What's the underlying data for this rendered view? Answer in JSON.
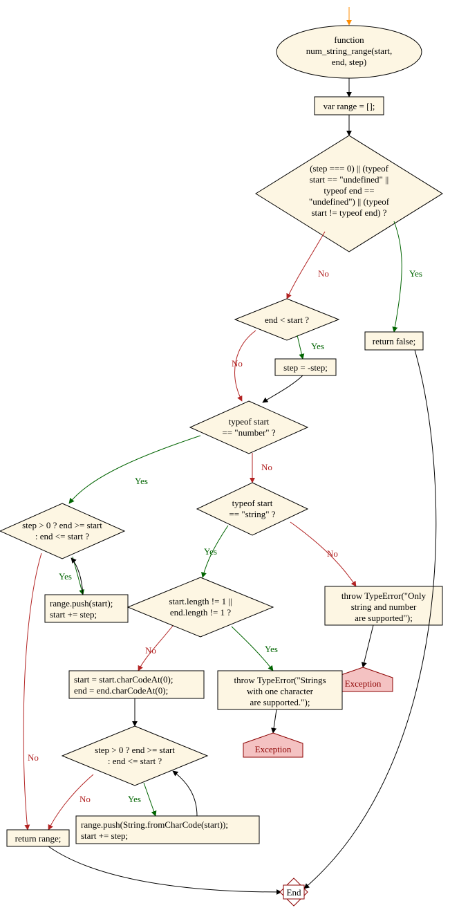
{
  "chart_data": {
    "type": "flowchart",
    "nodes": {
      "n_func": {
        "kind": "terminal",
        "lines": [
          "function",
          "num_string_range(start,",
          "end, step)"
        ]
      },
      "n_varr": {
        "kind": "process",
        "lines": [
          "var range = [];"
        ]
      },
      "n_check": {
        "kind": "decision",
        "lines": [
          "(step === 0) || (typeof",
          "start == \"undefined\" ||",
          "typeof end ==",
          "\"undefined\") || (typeof",
          "start != typeof end) ?"
        ]
      },
      "n_retf": {
        "kind": "process",
        "lines": [
          "return false;"
        ]
      },
      "n_endlt": {
        "kind": "decision",
        "lines": [
          "end < start ?"
        ]
      },
      "n_neg": {
        "kind": "process",
        "lines": [
          "step = -step;"
        ]
      },
      "n_isnum": {
        "kind": "decision",
        "lines": [
          "typeof start",
          "== \"number\" ?"
        ]
      },
      "n_isstr": {
        "kind": "decision",
        "lines": [
          "typeof start",
          "== \"string\" ?"
        ]
      },
      "n_len": {
        "kind": "decision",
        "lines": [
          "start.length != 1 ||",
          "end.length != 1 ?"
        ]
      },
      "n_terr1": {
        "kind": "process",
        "lines": [
          "throw TypeError(\"Only",
          "string and number",
          "are supported\");"
        ]
      },
      "n_terr2": {
        "kind": "process",
        "lines": [
          "throw TypeError(\"Strings",
          "with one character",
          "are supported.\");"
        ]
      },
      "n_exc1": {
        "kind": "exception",
        "lines": [
          "Exception"
        ]
      },
      "n_exc2": {
        "kind": "exception",
        "lines": [
          "Exception"
        ]
      },
      "n_loop1": {
        "kind": "decision",
        "lines": [
          "step > 0 ? end >= start",
          ": end <= start ?"
        ]
      },
      "n_body1": {
        "kind": "process",
        "lines": [
          "range.push(start);",
          "start += step;"
        ]
      },
      "n_code": {
        "kind": "process",
        "lines": [
          "start = start.charCodeAt(0);",
          "end = end.charCodeAt(0);"
        ]
      },
      "n_loop2": {
        "kind": "decision",
        "lines": [
          "step > 0 ? end >= start",
          ": end <= start ?"
        ]
      },
      "n_body2": {
        "kind": "process",
        "lines": [
          "range.push(String.fromCharCode(start));",
          "start += step;"
        ]
      },
      "n_retr": {
        "kind": "process",
        "lines": [
          "return range;"
        ]
      },
      "n_end": {
        "kind": "end",
        "lines": [
          "End"
        ]
      }
    },
    "edges": [
      {
        "from": "entry",
        "to": "n_func",
        "label": ""
      },
      {
        "from": "n_func",
        "to": "n_varr",
        "label": ""
      },
      {
        "from": "n_varr",
        "to": "n_check",
        "label": ""
      },
      {
        "from": "n_check",
        "to": "n_retf",
        "label": "Yes"
      },
      {
        "from": "n_check",
        "to": "n_endlt",
        "label": "No"
      },
      {
        "from": "n_endlt",
        "to": "n_neg",
        "label": "Yes"
      },
      {
        "from": "n_endlt",
        "to": "n_isnum",
        "label": "No"
      },
      {
        "from": "n_neg",
        "to": "n_isnum",
        "label": ""
      },
      {
        "from": "n_isnum",
        "to": "n_loop1",
        "label": "Yes"
      },
      {
        "from": "n_isnum",
        "to": "n_isstr",
        "label": "No"
      },
      {
        "from": "n_isstr",
        "to": "n_len",
        "label": "Yes"
      },
      {
        "from": "n_isstr",
        "to": "n_terr1",
        "label": "No"
      },
      {
        "from": "n_terr1",
        "to": "n_exc1",
        "label": ""
      },
      {
        "from": "n_len",
        "to": "n_terr2",
        "label": "Yes"
      },
      {
        "from": "n_len",
        "to": "n_code",
        "label": "No"
      },
      {
        "from": "n_terr2",
        "to": "n_exc2",
        "label": ""
      },
      {
        "from": "n_loop1",
        "to": "n_body1",
        "label": "Yes"
      },
      {
        "from": "n_body1",
        "to": "n_loop1",
        "label": ""
      },
      {
        "from": "n_loop1",
        "to": "n_retr",
        "label": "No"
      },
      {
        "from": "n_code",
        "to": "n_loop2",
        "label": ""
      },
      {
        "from": "n_loop2",
        "to": "n_body2",
        "label": "Yes"
      },
      {
        "from": "n_body2",
        "to": "n_loop2",
        "label": ""
      },
      {
        "from": "n_loop2",
        "to": "n_retr",
        "label": "No"
      },
      {
        "from": "n_retr",
        "to": "n_end",
        "label": ""
      },
      {
        "from": "n_retf",
        "to": "n_end",
        "label": ""
      }
    ],
    "labels": {
      "yes": "Yes",
      "no": "No"
    }
  }
}
